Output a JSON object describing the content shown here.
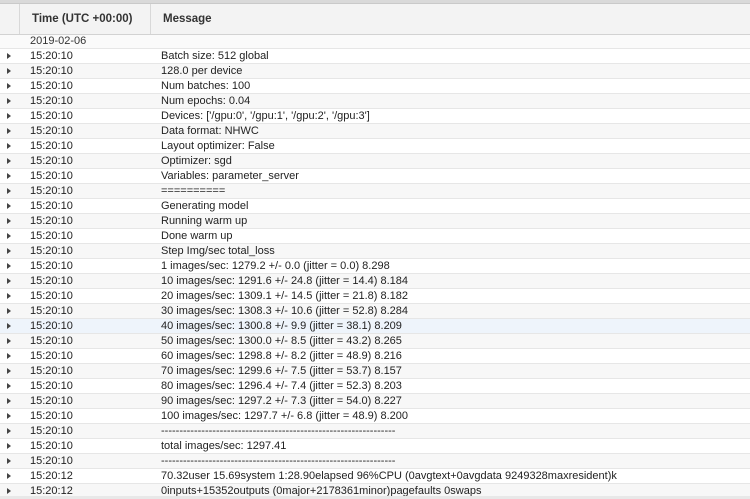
{
  "header": {
    "time_col": "Time (UTC +00:00)",
    "message_col": "Message"
  },
  "date": "2019-02-06",
  "rows": [
    {
      "time": "15:20:10",
      "message": "Batch size: 512 global"
    },
    {
      "time": "15:20:10",
      "message": "128.0 per device"
    },
    {
      "time": "15:20:10",
      "message": "Num batches: 100"
    },
    {
      "time": "15:20:10",
      "message": "Num epochs: 0.04"
    },
    {
      "time": "15:20:10",
      "message": "Devices: ['/gpu:0', '/gpu:1', '/gpu:2', '/gpu:3']"
    },
    {
      "time": "15:20:10",
      "message": "Data format: NHWC"
    },
    {
      "time": "15:20:10",
      "message": "Layout optimizer: False"
    },
    {
      "time": "15:20:10",
      "message": "Optimizer: sgd"
    },
    {
      "time": "15:20:10",
      "message": "Variables: parameter_server"
    },
    {
      "time": "15:20:10",
      "message": "=========="
    },
    {
      "time": "15:20:10",
      "message": "Generating model"
    },
    {
      "time": "15:20:10",
      "message": "Running warm up"
    },
    {
      "time": "15:20:10",
      "message": "Done warm up"
    },
    {
      "time": "15:20:10",
      "message": "Step Img/sec total_loss"
    },
    {
      "time": "15:20:10",
      "message": "1 images/sec: 1279.2 +/- 0.0 (jitter = 0.0) 8.298"
    },
    {
      "time": "15:20:10",
      "message": "10 images/sec: 1291.6 +/- 24.8 (jitter = 14.4) 8.184"
    },
    {
      "time": "15:20:10",
      "message": "20 images/sec: 1309.1 +/- 14.5 (jitter = 21.8) 8.182"
    },
    {
      "time": "15:20:10",
      "message": "30 images/sec: 1308.3 +/- 10.6 (jitter = 52.8) 8.284"
    },
    {
      "time": "15:20:10",
      "message": "40 images/sec: 1300.8 +/- 9.9 (jitter = 38.1) 8.209"
    },
    {
      "time": "15:20:10",
      "message": "50 images/sec: 1300.0 +/- 8.5 (jitter = 43.2) 8.265"
    },
    {
      "time": "15:20:10",
      "message": "60 images/sec: 1298.8 +/- 8.2 (jitter = 48.9) 8.216"
    },
    {
      "time": "15:20:10",
      "message": "70 images/sec: 1299.6 +/- 7.5 (jitter = 53.7) 8.157"
    },
    {
      "time": "15:20:10",
      "message": "80 images/sec: 1296.4 +/- 7.4 (jitter = 52.3) 8.203"
    },
    {
      "time": "15:20:10",
      "message": "90 images/sec: 1297.2 +/- 7.3 (jitter = 54.0) 8.227"
    },
    {
      "time": "15:20:10",
      "message": "100 images/sec: 1297.7 +/- 6.8 (jitter = 48.9) 8.200"
    },
    {
      "time": "15:20:10",
      "message": "----------------------------------------------------------------"
    },
    {
      "time": "15:20:10",
      "message": "total images/sec: 1297.41"
    },
    {
      "time": "15:20:10",
      "message": "----------------------------------------------------------------"
    },
    {
      "time": "15:20:12",
      "message": "70.32user 15.69system 1:28.90elapsed 96%CPU (0avgtext+0avgdata 9249328maxresident)k"
    },
    {
      "time": "15:20:12",
      "message": "0inputs+15352outputs (0major+2178361minor)pagefaults 0swaps"
    }
  ]
}
